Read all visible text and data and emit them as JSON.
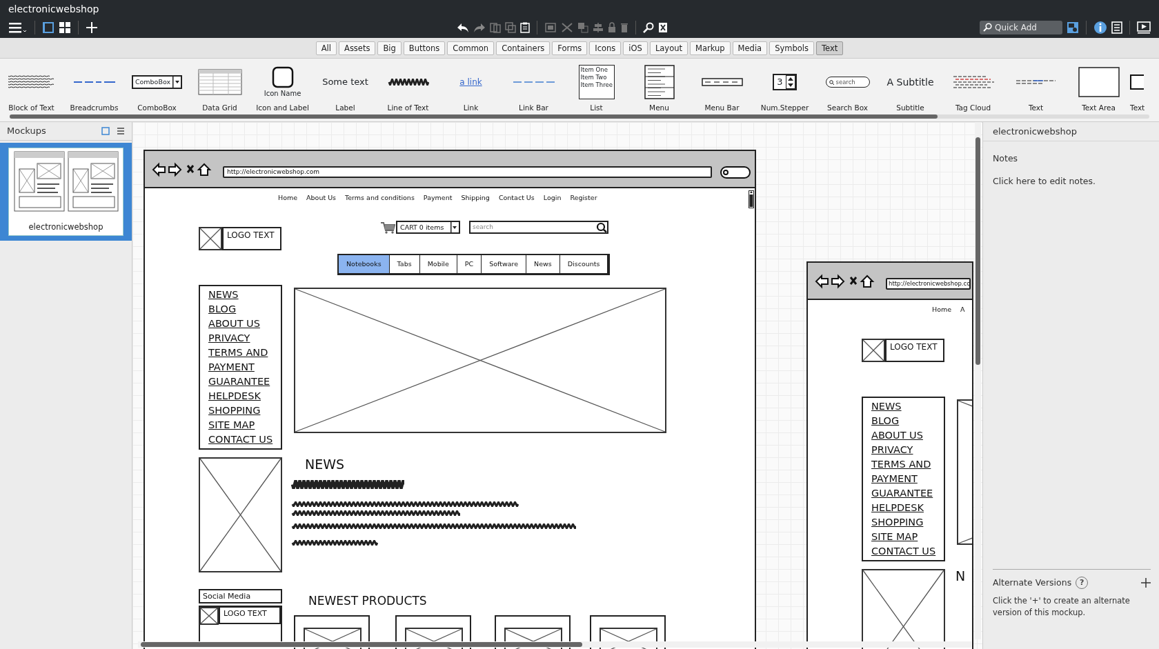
{
  "window": {
    "title": "electronicwebshop"
  },
  "quick_add": {
    "placeholder": "Quick Add"
  },
  "filters": [
    {
      "label": "All",
      "selected": false
    },
    {
      "label": "Assets",
      "selected": false
    },
    {
      "label": "Big",
      "selected": false
    },
    {
      "label": "Buttons",
      "selected": false
    },
    {
      "label": "Common",
      "selected": false
    },
    {
      "label": "Containers",
      "selected": false
    },
    {
      "label": "Forms",
      "selected": false
    },
    {
      "label": "Icons",
      "selected": false
    },
    {
      "label": "iOS",
      "selected": false
    },
    {
      "label": "Layout",
      "selected": false
    },
    {
      "label": "Markup",
      "selected": false
    },
    {
      "label": "Media",
      "selected": false
    },
    {
      "label": "Symbols",
      "selected": false
    },
    {
      "label": "Text",
      "selected": true
    }
  ],
  "palette": [
    {
      "label": "Block of Text",
      "kind": "block"
    },
    {
      "label": "Breadcrumbs",
      "kind": "breadcrumbs"
    },
    {
      "label": "ComboBox",
      "kind": "combobox",
      "preview": "ComboBox"
    },
    {
      "label": "Data Grid",
      "kind": "datagrid"
    },
    {
      "label": "Icon and Label",
      "kind": "iconlabel",
      "preview": "Icon Name"
    },
    {
      "label": "Label",
      "kind": "label",
      "preview": "Some text"
    },
    {
      "label": "Line of Text",
      "kind": "scribble"
    },
    {
      "label": "Link",
      "kind": "link",
      "preview": "a link"
    },
    {
      "label": "Link Bar",
      "kind": "linkbar"
    },
    {
      "label": "List",
      "kind": "list",
      "preview_items": [
        "Item One",
        "Item Two",
        "Item Three"
      ]
    },
    {
      "label": "Menu",
      "kind": "menu"
    },
    {
      "label": "Menu Bar",
      "kind": "menubar"
    },
    {
      "label": "Num.Stepper",
      "kind": "stepper",
      "preview": "3"
    },
    {
      "label": "Search Box",
      "kind": "searchbox",
      "preview": "search"
    },
    {
      "label": "Subtitle",
      "kind": "subtitle",
      "preview": "A Subtitle"
    },
    {
      "label": "Tag Cloud",
      "kind": "tagcloud"
    },
    {
      "label": "Text",
      "kind": "text"
    },
    {
      "label": "Text Area",
      "kind": "textarea"
    },
    {
      "label": "Text",
      "kind": "textinput"
    }
  ],
  "mockups_panel": {
    "title": "Mockups",
    "items": [
      {
        "label": "electronicwebshop",
        "selected": true
      }
    ]
  },
  "canvas": {
    "mockups": [
      {
        "url": "http://electronicwebshop.com",
        "nav_links": [
          "Home",
          "About Us",
          "Terms and conditions",
          "Payment",
          "Shipping",
          "Contact Us",
          "Login",
          "Register"
        ],
        "logo_text": "LOGO TEXT",
        "cart": "CART 0 items",
        "search_placeholder": "search",
        "tabs": [
          {
            "label": "Notebooks",
            "selected": true
          },
          {
            "label": "Tabs",
            "selected": false
          },
          {
            "label": "Mobile",
            "selected": false
          },
          {
            "label": "PC",
            "selected": false
          },
          {
            "label": "Software",
            "selected": false
          },
          {
            "label": "News",
            "selected": false
          },
          {
            "label": "Discounts",
            "selected": false
          }
        ],
        "menu": [
          "NEWS",
          "BLOG",
          "ABOUT US",
          "PRIVACY",
          "TERMS AND",
          "PAYMENT",
          "GUARANTEE",
          "HELPDESK",
          "SHOPPING",
          "SITE MAP",
          "CONTACT US"
        ],
        "news_heading": "NEWS",
        "products_heading": "NEWEST PRODUCTS",
        "social_label": "Social Media",
        "social_logo_text": "LOGO TEXT"
      },
      {
        "url": "http://electronicwebshop.co",
        "nav_links": [
          "Home",
          "A"
        ],
        "logo_text": "LOGO TEXT",
        "menu": [
          "NEWS",
          "BLOG",
          "ABOUT US",
          "PRIVACY",
          "TERMS AND",
          "PAYMENT",
          "GUARANTEE",
          "HELPDESK",
          "SHOPPING",
          "SITE MAP",
          "CONTACT US"
        ],
        "news_heading": "N"
      }
    ]
  },
  "inspector": {
    "title": "electronicwebshop",
    "notes_label": "Notes",
    "notes": "Click here to edit notes.",
    "alt_title": "Alternate Versions",
    "alt_help": "?",
    "alt_text": "Click the '+' to create an alternate version of this mockup."
  }
}
